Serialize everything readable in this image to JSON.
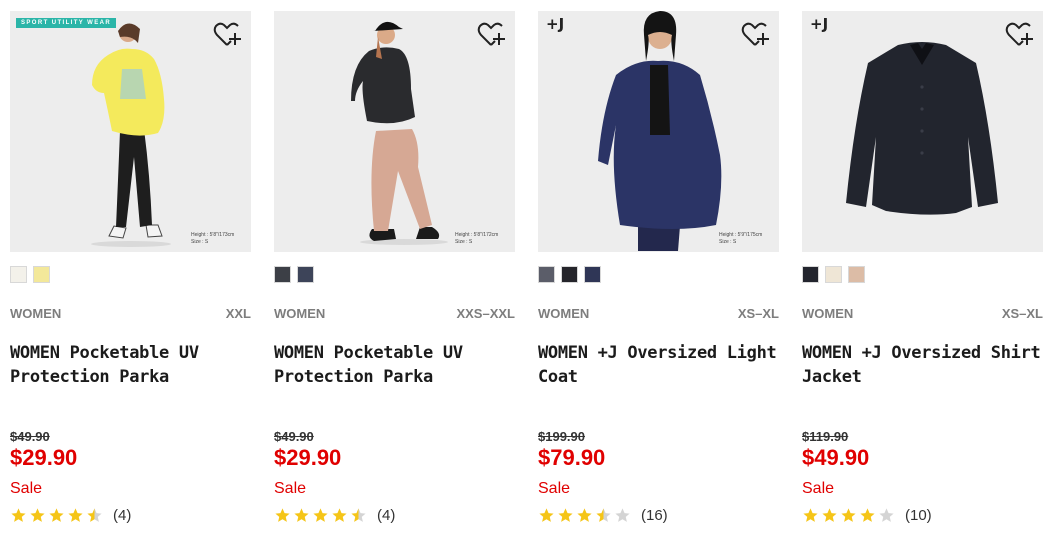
{
  "colors": {
    "sale_red": "#e00000",
    "star_gold": "#f5c518",
    "star_empty": "#d4d4d4"
  },
  "products": [
    {
      "badge": "SPORT UTILITY WEAR",
      "plusj": "",
      "height_note": [
        "Height : 5'8\"/173cm",
        "Size : S"
      ],
      "swatches": [
        "#f3f1ea",
        "#f3e89a"
      ],
      "category": "WOMEN",
      "size": "XXL",
      "title": "WOMEN Pocketable UV Protection Parka",
      "orig_price": "$49.90",
      "price": "$29.90",
      "sale": "Sale",
      "rating": 4.5,
      "count": "(4)"
    },
    {
      "badge": "",
      "plusj": "",
      "height_note": [
        "Height : 5'8\"/172cm",
        "Size : S"
      ],
      "swatches": [
        "#3c3f46",
        "#3d4459"
      ],
      "category": "WOMEN",
      "size": "XXS–XXL",
      "title": "WOMEN Pocketable UV Protection Parka",
      "orig_price": "$49.90",
      "price": "$29.90",
      "sale": "Sale",
      "rating": 4.5,
      "count": "(4)"
    },
    {
      "badge": "",
      "plusj": "+J",
      "height_note": [
        "Height : 5'9\"/175cm",
        "Size : S"
      ],
      "swatches": [
        "#5b5d69",
        "#25252b",
        "#2f3656"
      ],
      "category": "WOMEN",
      "size": "XS–XL",
      "title": "WOMEN +J Oversized Light Coat",
      "orig_price": "$199.90",
      "price": "$79.90",
      "sale": "Sale",
      "rating": 3.5,
      "count": "(16)"
    },
    {
      "badge": "",
      "plusj": "+J",
      "height_note": [],
      "swatches": [
        "#23252e",
        "#efe6d6",
        "#dcbca6"
      ],
      "category": "WOMEN",
      "size": "XS–XL",
      "title": "WOMEN +J Oversized Shirt Jacket",
      "orig_price": "$119.90",
      "price": "$49.90",
      "sale": "Sale",
      "rating": 4,
      "count": "(10)"
    }
  ]
}
